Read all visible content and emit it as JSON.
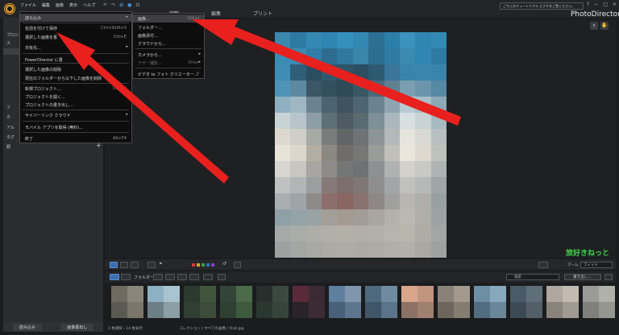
{
  "app": {
    "name": "PhotoDirector",
    "menubar": [
      "ファイル",
      "編集",
      "画像",
      "表示",
      "ヘルプ"
    ],
    "tutorial": "ごちらかチュートリアル ビデオをご覧ください。",
    "mode_tabs": [
      "調整",
      "編集",
      "プリント"
    ],
    "window_controls": [
      "?",
      "−",
      "□",
      "×"
    ],
    "watermark": "旅好きねっと"
  },
  "file_menu": {
    "items": [
      {
        "label": "読み込み",
        "shortcut": "",
        "submenu": true,
        "highlight": true
      },
      {
        "label": "名前を付けて保存",
        "shortcut": "Ctrl+Shift+S"
      },
      {
        "label": "選択した画像を書",
        "shortcut": "Ctrl+E"
      },
      {
        "label": "共有先...",
        "shortcut": "",
        "submenu": true
      },
      {
        "label": "PowerDirector に書",
        "shortcut": ""
      },
      {
        "label": "選択した画像の削除",
        "shortcut": ""
      },
      {
        "label": "現在のフォルダーから以下した画像を削除",
        "shortcut": ""
      },
      {
        "label": "新規プロジェクト...",
        "shortcut": "Ctrl+N"
      },
      {
        "label": "プロジェクトを開く...",
        "shortcut": ""
      },
      {
        "label": "プロジェクトの書き出し...",
        "shortcut": ""
      },
      {
        "label": "サイバーリンク クラウド",
        "shortcut": "",
        "submenu": true
      },
      {
        "label": "モバイル アプリを取得 (無料)...",
        "shortcut": ""
      },
      {
        "label": "終了",
        "shortcut": "Alt+F4"
      }
    ]
  },
  "import_submenu": {
    "items": [
      {
        "label": "画像...",
        "shortcut": "Ctrl+I",
        "highlight": true
      },
      {
        "label": "フォルダー...",
        "shortcut": ""
      },
      {
        "label": "画像添付...",
        "shortcut": ""
      },
      {
        "label": "クラウドから...",
        "shortcut": ""
      },
      {
        "label": "カメラから...",
        "shortcut": "",
        "submenu": true
      },
      {
        "label": "テザー撮影...",
        "shortcut": "Enter",
        "submenu": true,
        "disabled": true
      },
      {
        "label": "ビデオ to フォト クリエーター...",
        "shortcut": "V"
      }
    ]
  },
  "left_panel": {
    "rows": [
      "プロジェクト",
      "ス",
      "フ",
      "カ",
      "アル",
      "タグ",
      "顔"
    ],
    "plus": "+",
    "buttons": [
      "読み込み",
      "画像書出し"
    ]
  },
  "filmstrip": {
    "folder_label": "フォルダー",
    "search_placeholder": "検索",
    "export_label": "書き出し...",
    "zoom_label": "ズーム",
    "zoom_value": "フィット"
  },
  "status": {
    "count": "1 枚選択・14 枚表示",
    "path": "コレクション / すべての画像 / ifcat.jpg"
  },
  "colors": {
    "accent": "#3a6fb0",
    "arrow": "#e8201e",
    "menu_bg": "#0d0d0e",
    "logo": "#f1a21d",
    "watermark": "#3bd34a"
  }
}
